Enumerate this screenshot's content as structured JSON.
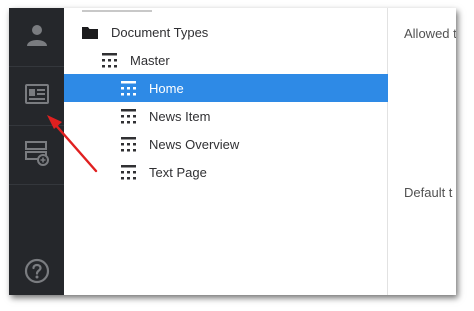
{
  "rail": {
    "items": [
      {
        "name": "user-icon"
      },
      {
        "name": "id-card-icon"
      },
      {
        "name": "document-add-icon"
      },
      {
        "name": "help-icon"
      }
    ],
    "color": "#25272b",
    "icon_color": "#7a7c80"
  },
  "tree": {
    "items": [
      {
        "label": "Document Types",
        "icon": "folder-icon"
      },
      {
        "label": "Master",
        "icon": "doctype-icon"
      },
      {
        "label": "Home",
        "icon": "doctype-icon",
        "selected": true
      },
      {
        "label": "News Item",
        "icon": "doctype-icon"
      },
      {
        "label": "News Overview",
        "icon": "doctype-icon"
      },
      {
        "label": "Text Page",
        "icon": "doctype-icon"
      }
    ],
    "selected_color": "#2e8ae6"
  },
  "content": {
    "allowed_label": "Allowed t",
    "default_label": "Default t"
  },
  "annotation": {
    "arrow_color": "#e02020"
  }
}
